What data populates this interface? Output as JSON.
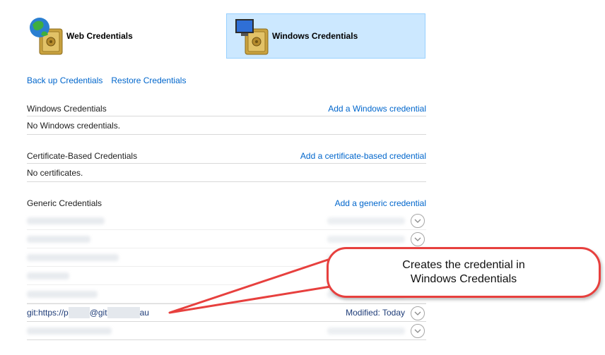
{
  "tabs": {
    "web_label": "Web Credentials",
    "windows_label": "Windows Credentials"
  },
  "actions": {
    "backup_label": "Back up Credentials",
    "restore_label": "Restore Credentials"
  },
  "sections": {
    "windows": {
      "title": "Windows Credentials",
      "add_label": "Add a Windows credential",
      "empty_text": "No Windows credentials."
    },
    "certificate": {
      "title": "Certificate-Based Credentials",
      "add_label": "Add a certificate-based credential",
      "empty_text": "No certificates."
    },
    "generic": {
      "title": "Generic Credentials",
      "add_label": "Add a generic credential"
    }
  },
  "generic_entry": {
    "name_prefix": "git:https://p",
    "name_mid": "@git",
    "name_suffix": "au",
    "modified_label": "Modified:",
    "modified_value": "Today"
  },
  "callout": {
    "text": "Creates the credential in Windows Credentials",
    "border_color": "#e7403e"
  },
  "colors": {
    "link": "#0066cc",
    "selected_tab_bg": "#cce8ff"
  }
}
